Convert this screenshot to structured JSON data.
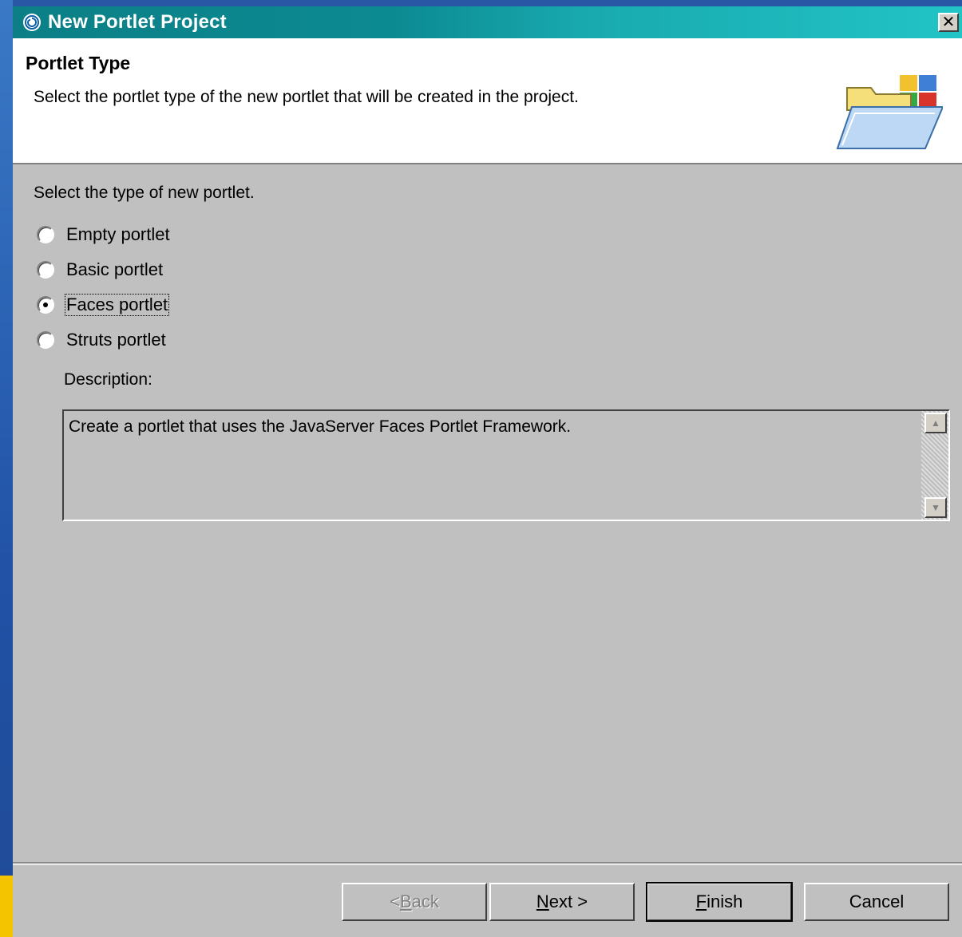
{
  "window": {
    "title": "New Portlet Project",
    "close_glyph": "✕"
  },
  "banner": {
    "title": "Portlet Type",
    "description": "Select the portlet type of the new portlet that will be created in the project.",
    "graphic_icon": "open-folder-icon"
  },
  "form": {
    "prompt": "Select the type of new portlet.",
    "options": [
      {
        "label": "Empty portlet",
        "checked": false
      },
      {
        "label": "Basic portlet",
        "checked": false
      },
      {
        "label": "Faces portlet",
        "checked": true
      },
      {
        "label": "Struts portlet",
        "checked": false
      }
    ],
    "description_label": "Description:",
    "description_text": "Create a portlet that uses the JavaServer Faces Portlet Framework."
  },
  "buttons": {
    "back": {
      "pre": "< ",
      "mnemonic": "B",
      "rest": "ack"
    },
    "next": {
      "mnemonic": "N",
      "rest": "ext >"
    },
    "finish": {
      "mnemonic": "F",
      "rest": "inish"
    },
    "cancel": "Cancel"
  }
}
